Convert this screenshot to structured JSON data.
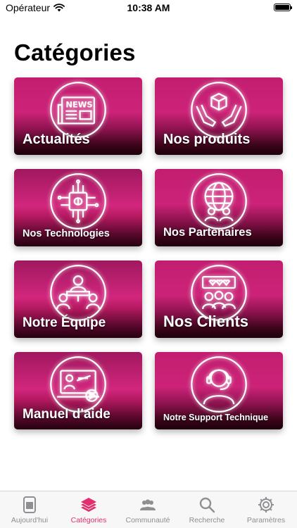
{
  "status_bar": {
    "carrier": "Opérateur",
    "time": "10:38 AM"
  },
  "page_title": "Catégories",
  "categories": [
    {
      "label": "Actualités",
      "icon": "news-icon"
    },
    {
      "label": "Nos produits",
      "icon": "product-box-hands-icon"
    },
    {
      "label": "Nos Technologies",
      "icon": "chip-brain-icon"
    },
    {
      "label": "Nos Partenaires",
      "icon": "globe-people-icon"
    },
    {
      "label": "Notre Équipe",
      "icon": "team-meeting-icon"
    },
    {
      "label": "Nos Clients",
      "icon": "clients-hearts-icon"
    },
    {
      "label": "Manuel d'aide",
      "icon": "video-tutorial-icon"
    },
    {
      "label": "Notre Support Technique",
      "icon": "support-headset-icon"
    }
  ],
  "tab_bar": {
    "active_color": "#e0306f",
    "inactive_color": "#8e8e93",
    "tabs": [
      {
        "label": "Aujourd'hui",
        "icon": "today-icon"
      },
      {
        "label": "Catégories",
        "icon": "layers-icon",
        "active": true
      },
      {
        "label": "Communauté",
        "icon": "community-icon"
      },
      {
        "label": "Recherche",
        "icon": "search-icon"
      },
      {
        "label": "Paramètres",
        "icon": "settings-gear-icon"
      }
    ]
  },
  "colors": {
    "card_magenta": "#d2267d",
    "card_dark": "#25010f"
  }
}
